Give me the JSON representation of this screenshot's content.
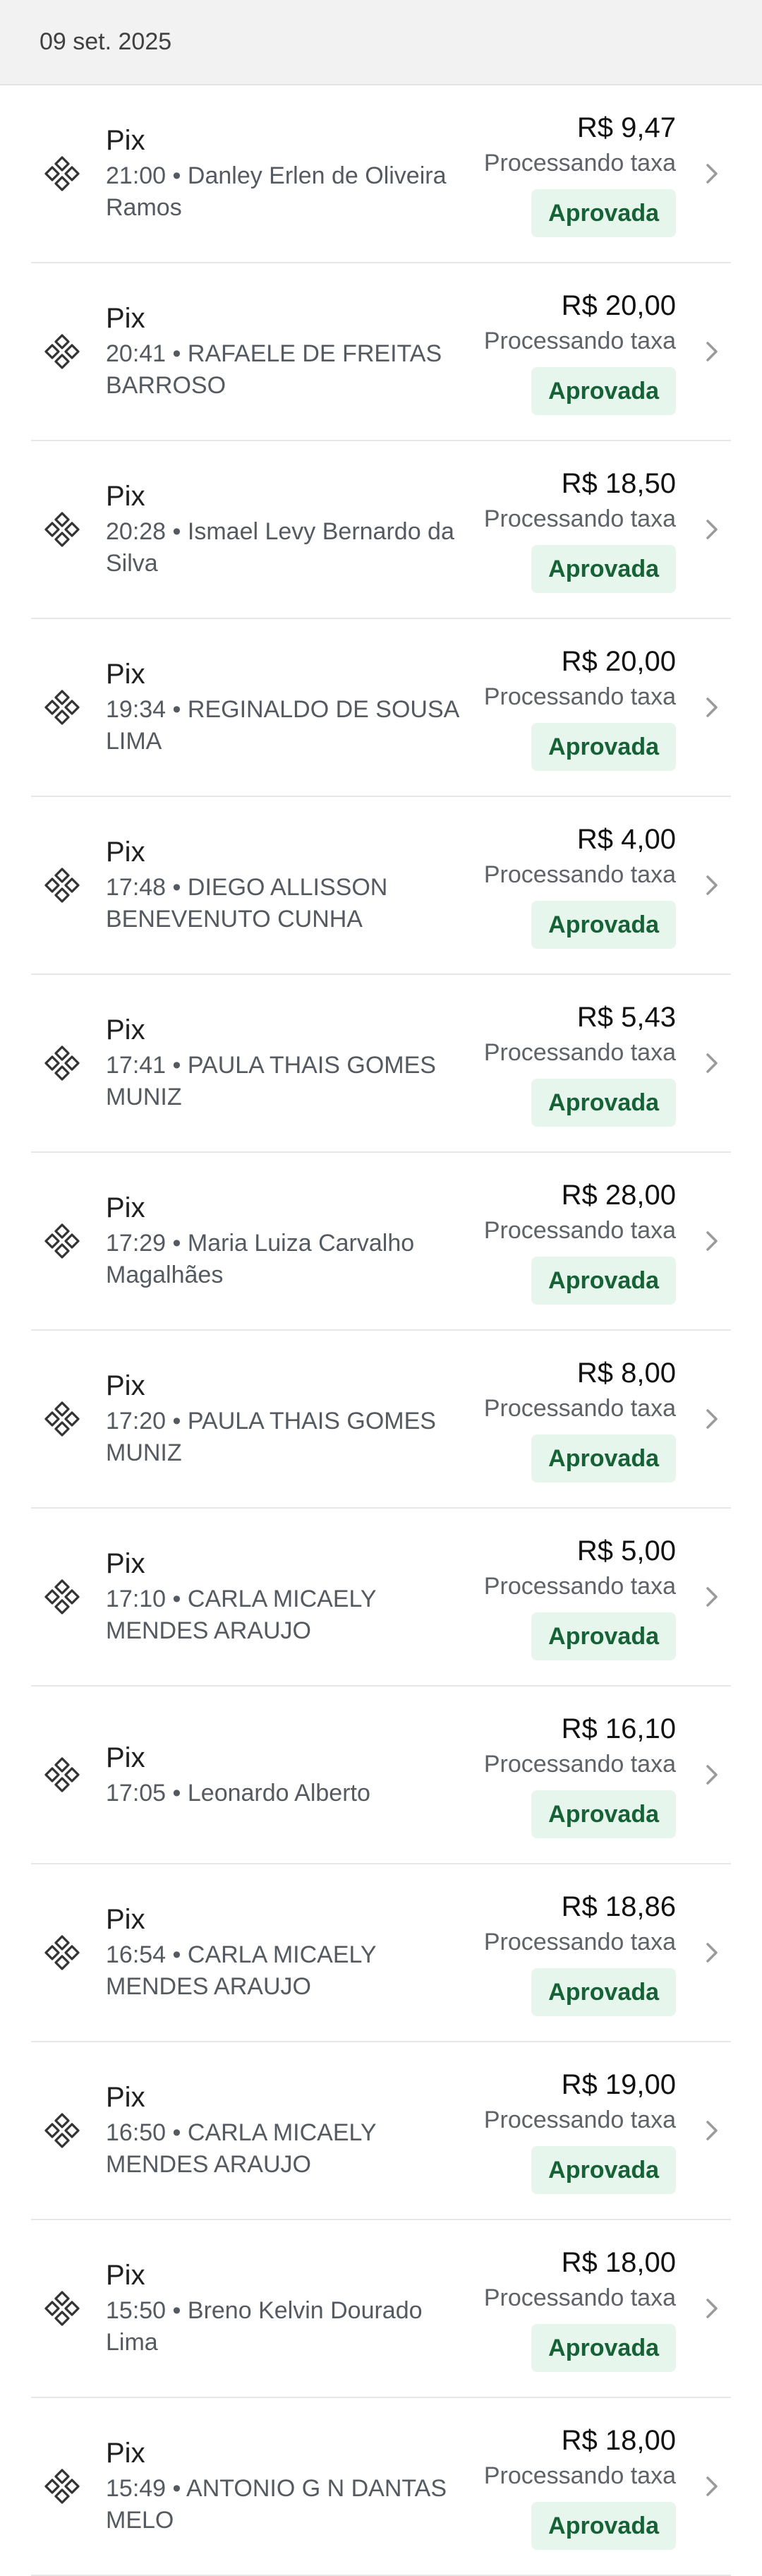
{
  "header": {
    "date": "09 set. 2025"
  },
  "icons": {
    "transaction": "pix-icon",
    "chevron": "chevron-right-icon"
  },
  "colors": {
    "badge_bg": "#e6f6ec",
    "badge_text": "#176136"
  },
  "transactions": [
    {
      "title": "Pix",
      "time": "21:00",
      "name": "Danley Erlen de Oliveira Ramos",
      "amount": "R$ 9,47",
      "fee": "Processando taxa",
      "status": "Aprovada"
    },
    {
      "title": "Pix",
      "time": "20:41",
      "name": "RAFAELE DE FREITAS BARROSO",
      "amount": "R$ 20,00",
      "fee": "Processando taxa",
      "status": "Aprovada"
    },
    {
      "title": "Pix",
      "time": "20:28",
      "name": "Ismael Levy Bernardo da Silva",
      "amount": "R$ 18,50",
      "fee": "Processando taxa",
      "status": "Aprovada"
    },
    {
      "title": "Pix",
      "time": "19:34",
      "name": "REGINALDO DE SOUSA LIMA",
      "amount": "R$ 20,00",
      "fee": "Processando taxa",
      "status": "Aprovada"
    },
    {
      "title": "Pix",
      "time": "17:48",
      "name": "DIEGO ALLISSON BENEVENUTO CUNHA",
      "amount": "R$ 4,00",
      "fee": "Processando taxa",
      "status": "Aprovada"
    },
    {
      "title": "Pix",
      "time": "17:41",
      "name": "PAULA THAIS GOMES MUNIZ",
      "amount": "R$ 5,43",
      "fee": "Processando taxa",
      "status": "Aprovada"
    },
    {
      "title": "Pix",
      "time": "17:29",
      "name": "Maria Luiza Carvalho Magalhães",
      "amount": "R$ 28,00",
      "fee": "Processando taxa",
      "status": "Aprovada"
    },
    {
      "title": "Pix",
      "time": "17:20",
      "name": "PAULA THAIS GOMES MUNIZ",
      "amount": "R$ 8,00",
      "fee": "Processando taxa",
      "status": "Aprovada"
    },
    {
      "title": "Pix",
      "time": "17:10",
      "name": "CARLA MICAELY MENDES ARAUJO",
      "amount": "R$ 5,00",
      "fee": "Processando taxa",
      "status": "Aprovada"
    },
    {
      "title": "Pix",
      "time": "17:05",
      "name": "Leonardo Alberto",
      "amount": "R$ 16,10",
      "fee": "Processando taxa",
      "status": "Aprovada"
    },
    {
      "title": "Pix",
      "time": "16:54",
      "name": "CARLA MICAELY MENDES ARAUJO",
      "amount": "R$ 18,86",
      "fee": "Processando taxa",
      "status": "Aprovada"
    },
    {
      "title": "Pix",
      "time": "16:50",
      "name": "CARLA MICAELY MENDES ARAUJO",
      "amount": "R$ 19,00",
      "fee": "Processando taxa",
      "status": "Aprovada"
    },
    {
      "title": "Pix",
      "time": "15:50",
      "name": "Breno Kelvin Dourado Lima",
      "amount": "R$ 18,00",
      "fee": "Processando taxa",
      "status": "Aprovada"
    },
    {
      "title": "Pix",
      "time": "15:49",
      "name": "ANTONIO G N DANTAS MELO",
      "amount": "R$ 18,00",
      "fee": "Processando taxa",
      "status": "Aprovada"
    }
  ]
}
